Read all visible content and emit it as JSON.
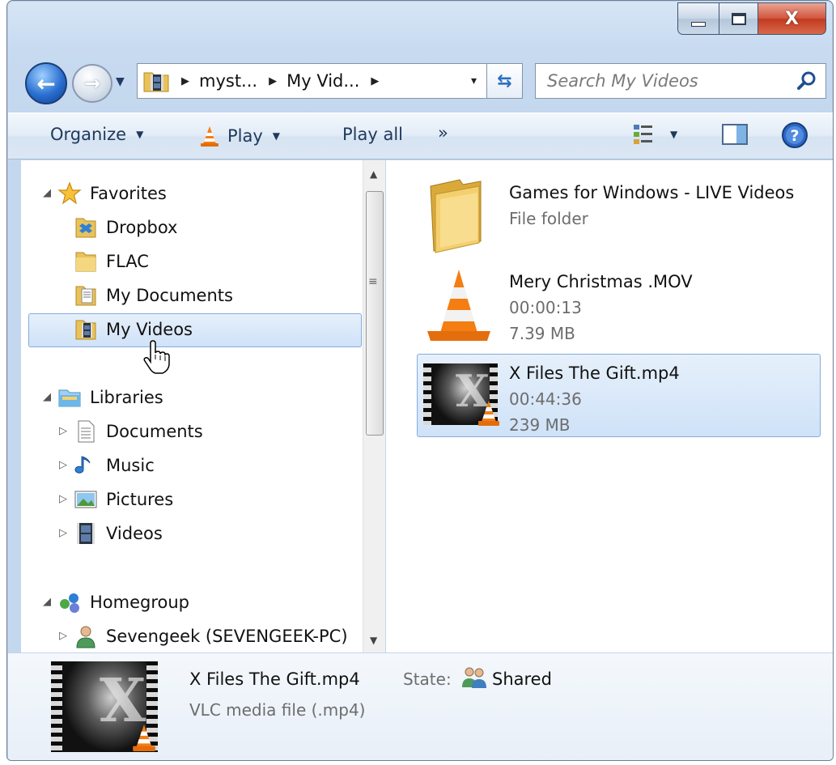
{
  "window": {
    "caption": {
      "minimize": "",
      "maximize": "",
      "close": "X"
    }
  },
  "address_bar": {
    "crumbs": [
      "myst...",
      "My Vid..."
    ],
    "dropdown": "▾",
    "refresh_glyph": "⇆"
  },
  "search": {
    "placeholder": "Search My Videos"
  },
  "command_bar": {
    "organize": "Organize",
    "play": "Play",
    "play_all": "Play all",
    "more": "»"
  },
  "navigation": {
    "favorites": {
      "label": "Favorites",
      "items": [
        "Dropbox",
        "FLAC",
        "My Documents",
        "My Videos"
      ]
    },
    "libraries": {
      "label": "Libraries",
      "items": [
        "Documents",
        "Music",
        "Pictures",
        "Videos"
      ]
    },
    "homegroup": {
      "label": "Homegroup",
      "items": [
        "Sevengeek (SEVENGEEK-PC)"
      ]
    },
    "selected": "My Videos"
  },
  "files": [
    {
      "name": "Games for Windows - LIVE Videos",
      "line2": "File folder",
      "line3": "",
      "icon": "folder-icon"
    },
    {
      "name": "Mery Christmas .MOV",
      "line2": "00:00:13",
      "line3": "7.39 MB",
      "icon": "vlc-cone-icon"
    },
    {
      "name": "X Files The Gift.mp4",
      "line2": "00:44:36",
      "line3": "239 MB",
      "icon": "video-thumbnail"
    }
  ],
  "details": {
    "name": "X Files The Gift.mp4",
    "type": "VLC media file (.mp4)",
    "state_label": "State:",
    "state_value": "Shared"
  },
  "colors": {
    "selection_bg": "#cfe2f8",
    "selection_border": "#84acdd",
    "command_text": "#1e395b",
    "secondary_text": "#6d6d6d"
  }
}
